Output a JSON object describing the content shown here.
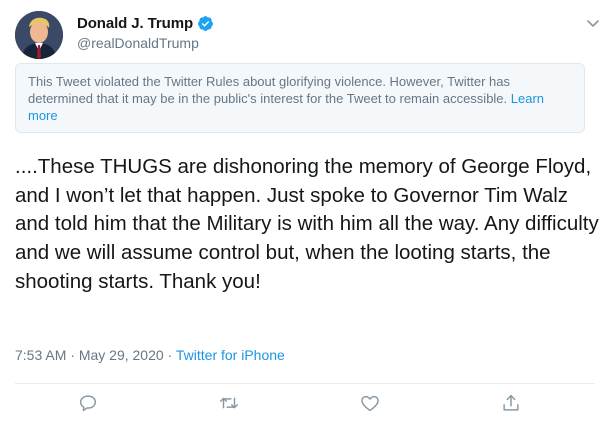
{
  "author": {
    "display_name": "Donald J. Trump",
    "handle": "@realDonaldTrump",
    "verified_icon": "verified-badge-icon",
    "avatar_icon": "avatar"
  },
  "notice": {
    "text": "This Tweet violated the Twitter Rules about glorifying violence. However, Twitter has determined that it may be in the public's interest for the Tweet to remain accessible.",
    "link_label": "Learn more"
  },
  "tweet": {
    "text": "....These THUGS are dishonoring the memory of George Floyd, and I won’t let that happen. Just spoke to Governor Tim Walz and told him that the Military is with him all the way. Any difficulty and we will assume control but, when the looting starts, the shooting starts. Thank you!",
    "time": "7:53 AM",
    "separator": "·",
    "date": "May 29, 2020",
    "source": "Twitter for iPhone"
  },
  "actions": {
    "reply_icon": "reply-icon",
    "retweet_icon": "retweet-icon",
    "like_icon": "like-icon",
    "share_icon": "share-icon"
  },
  "colors": {
    "accent": "#1b95e0",
    "secondary_text": "#657786",
    "notice_bg": "#f5f8fa",
    "border": "#e1e8ed"
  }
}
